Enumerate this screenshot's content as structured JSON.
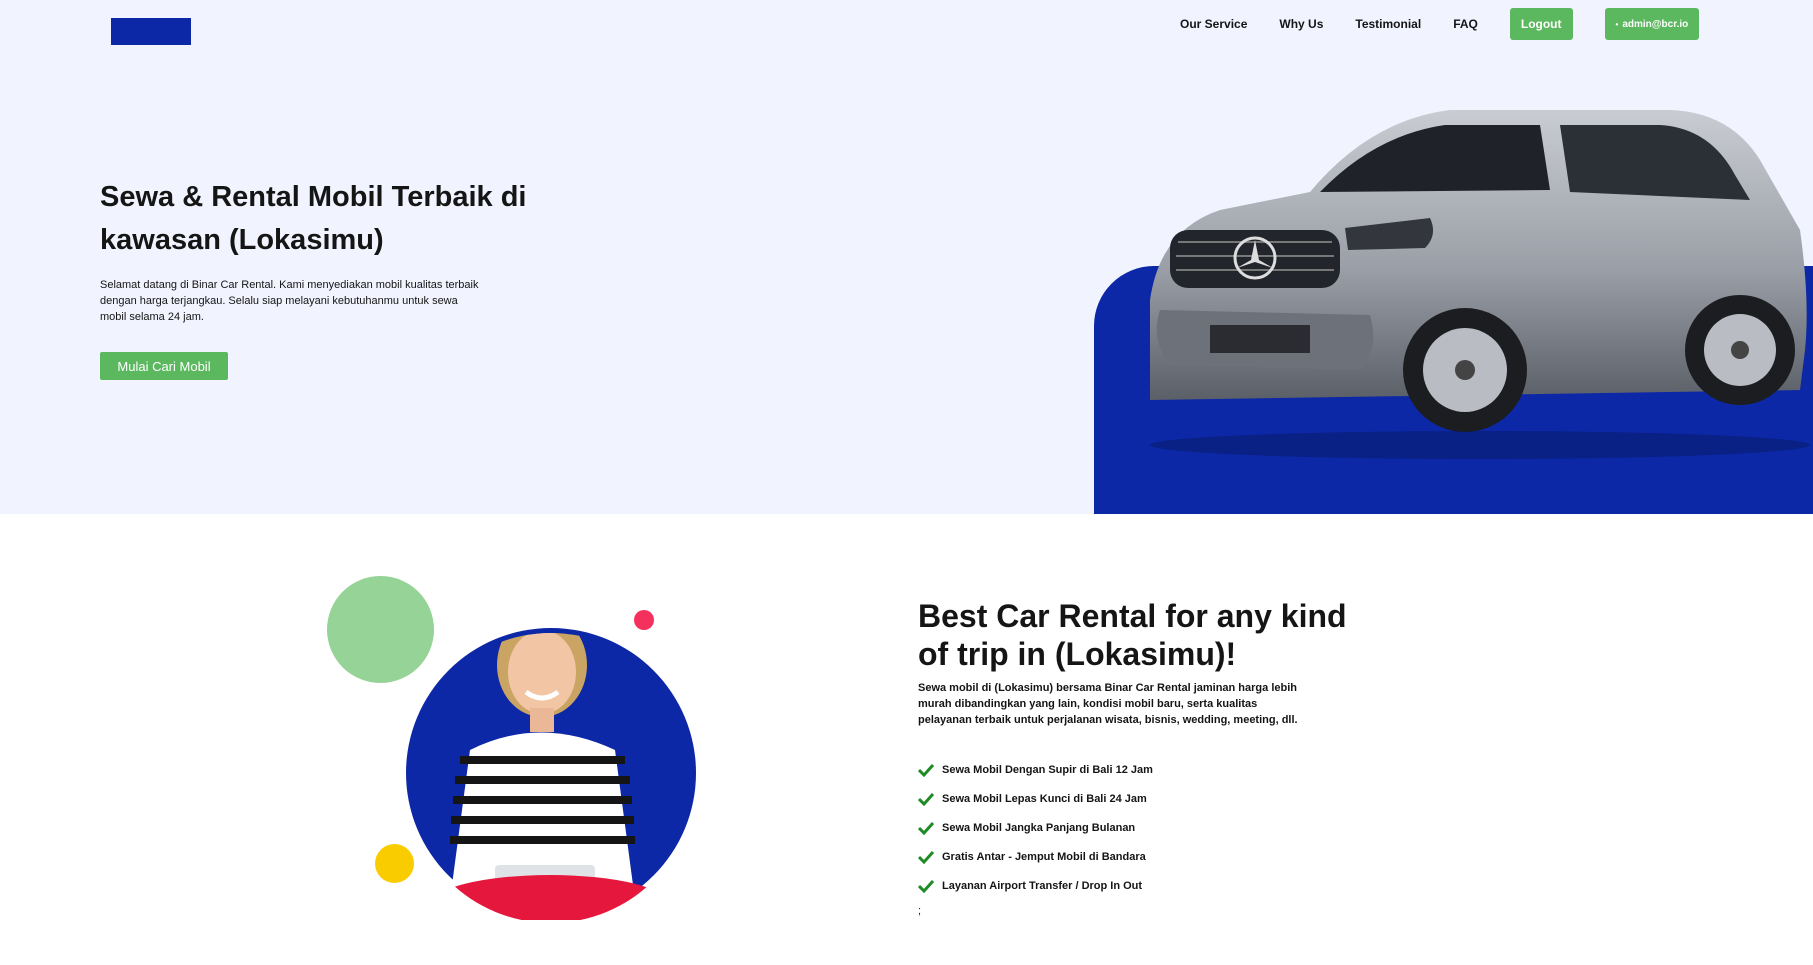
{
  "nav": {
    "links": [
      "Our Service",
      "Why Us",
      "Testimonial",
      "FAQ"
    ],
    "logout_label": "Logout",
    "user_email": "admin@bcr.io"
  },
  "hero": {
    "title": "Sewa & Rental Mobil Terbaik di kawasan (Lokasimu)",
    "description": "Selamat datang di Binar Car Rental. Kami menyediakan mobil kualitas terbaik dengan harga terjangkau. Selalu siap melayani kebutuhanmu untuk sewa mobil selama 24 jam.",
    "cta_label": "Mulai Cari Mobil"
  },
  "why": {
    "title": "Best Car Rental for any kind of trip in (Lokasimu)!",
    "description": "Sewa mobil di (Lokasimu) bersama Binar Car Rental jaminan harga lebih murah dibandingkan yang lain, kondisi mobil baru, serta kualitas pelayanan terbaik untuk perjalanan wisata, bisnis, wedding, meeting, dll.",
    "items": [
      "Sewa Mobil Dengan Supir di Bali 12 Jam",
      "Sewa Mobil Lepas Kunci di Bali 24 Jam",
      "Sewa Mobil Jangka Panjang Bulanan",
      "Gratis Antar - Jemput Mobil di Bandara",
      "Layanan Airport Transfer / Drop In Out"
    ],
    "trailing_text": ";"
  },
  "colors": {
    "brand_blue": "#0d28a6",
    "accent_green": "#5cb85f",
    "hero_bg": "#f1f3ff"
  },
  "icons": {
    "check": "check-icon",
    "user_dot": "user-dot-icon"
  }
}
